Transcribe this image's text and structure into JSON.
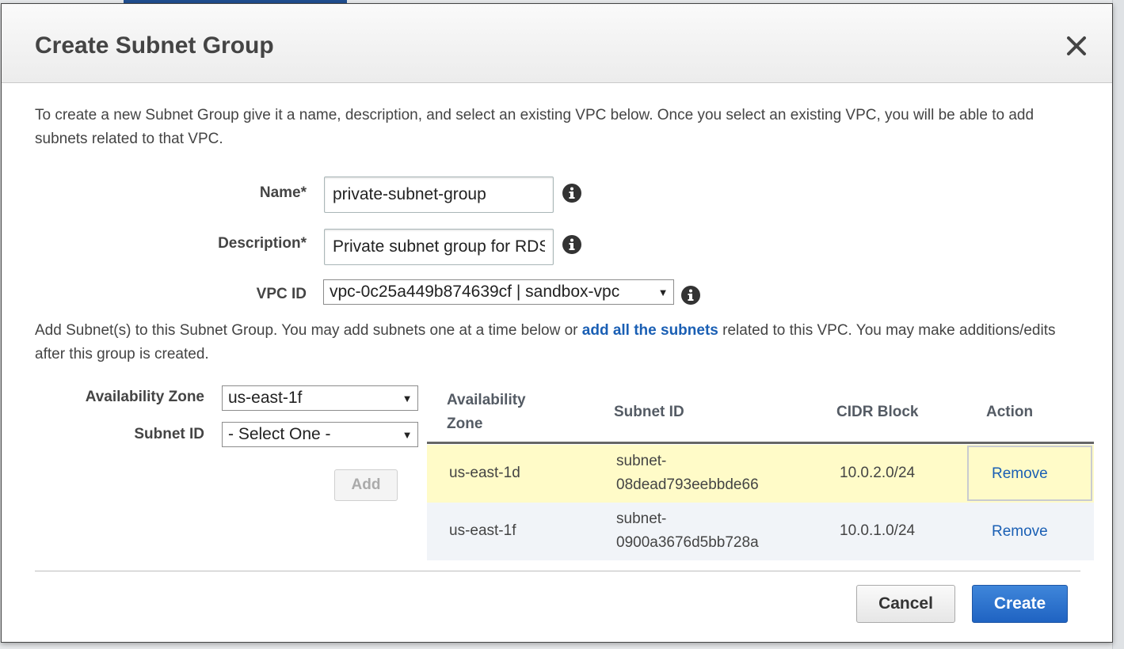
{
  "dialog": {
    "title": "Create Subnet Group",
    "intro": "To create a new Subnet Group give it a name, description, and select an existing VPC below. Once you select an existing VPC, you will be able to add subnets related to that VPC."
  },
  "form": {
    "name_label": "Name*",
    "name_value": "private-subnet-group",
    "description_label": "Description*",
    "description_value": "Private subnet group for RDS",
    "vpc_label": "VPC ID",
    "vpc_value": "vpc-0c25a449b874639cf | sandbox-vpc"
  },
  "subnets_section": {
    "text_before": "Add Subnet(s) to this Subnet Group. You may add subnets one at a time below or ",
    "link": "add all the subnets",
    "text_after": " related to this VPC. You may make additions/edits after this group is created.",
    "az_label": "Availability Zone",
    "az_value": "us-east-1f",
    "subnet_label": "Subnet ID",
    "subnet_value": "- Select One -",
    "add_button": "Add"
  },
  "table": {
    "headers": [
      "Availability Zone",
      "Subnet ID",
      "CIDR Block",
      "Action"
    ],
    "rows": [
      {
        "az": "us-east-1d",
        "subnet_line1": "subnet-",
        "subnet_line2": "08dead793eebbde66",
        "cidr": "10.0.2.0/24",
        "action": "Remove"
      },
      {
        "az": "us-east-1f",
        "subnet_line1": "subnet-",
        "subnet_line2": "0900a3676d5bb728a",
        "cidr": "10.0.1.0/24",
        "action": "Remove"
      }
    ]
  },
  "footer": {
    "cancel": "Cancel",
    "create": "Create"
  },
  "icons": {
    "close": "close-icon",
    "info": "info-icon",
    "dropdown": "chevron-down-icon"
  },
  "colors": {
    "primary": "#1f63c2",
    "link": "#1a5fb4",
    "highlight_row": "#fffbc8"
  }
}
